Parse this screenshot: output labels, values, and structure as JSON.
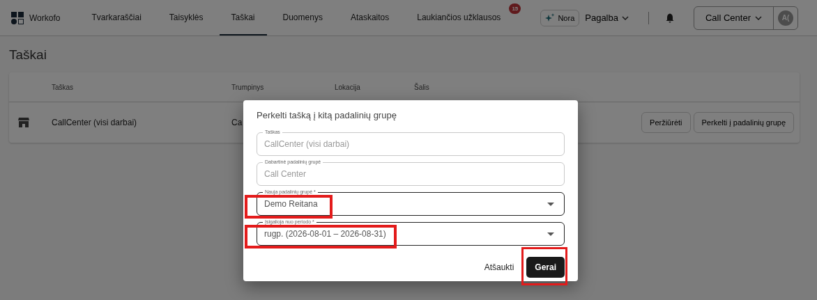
{
  "nav": {
    "brand": "Workofo",
    "tabs": [
      {
        "label": "Tvarkaraščiai",
        "selected": false
      },
      {
        "label": "Taisyklės",
        "selected": false
      },
      {
        "label": "Taškai",
        "selected": true
      },
      {
        "label": "Duomenys",
        "selected": false
      },
      {
        "label": "Ataskaitos",
        "selected": false
      },
      {
        "label": "Laukiančios užklausos",
        "selected": false,
        "badge": "15"
      }
    ],
    "assistant": "Nora",
    "help": "Pagalba",
    "workspace": "Call Center",
    "avatar": "A("
  },
  "page": {
    "title": "Taškai",
    "table": {
      "columns": [
        "Taškas",
        "Trumpinys",
        "Lokacija",
        "Šalis"
      ],
      "rows": [
        {
          "name": "CallCenter (visi darbai)",
          "short": "Ca",
          "actions": [
            "Peržiūrėti",
            "Perkelti į padalinių grupę"
          ]
        }
      ]
    }
  },
  "dialog": {
    "title": "Perkelti tašką į kitą padalinių grupę",
    "fields": [
      {
        "label": "Taškas",
        "value": "CallCenter (visi darbai)",
        "kind": "text",
        "disabled": true,
        "highlighted": false
      },
      {
        "label": "Dabartinė padalinių grupė",
        "value": "Call Center",
        "kind": "text",
        "disabled": true,
        "highlighted": false
      },
      {
        "label": "Nauja padalinių grupė *",
        "value": "Demo Reitana",
        "kind": "select",
        "disabled": false,
        "highlighted": true
      },
      {
        "label": "Įsigalioja nuo periodo *",
        "value": "rugp. (2026-08-01 – 2026-08-31)",
        "kind": "select",
        "disabled": false,
        "highlighted": true
      }
    ],
    "cancel": "Atšaukti",
    "ok": {
      "label": "Gerai",
      "highlighted": true
    }
  }
}
